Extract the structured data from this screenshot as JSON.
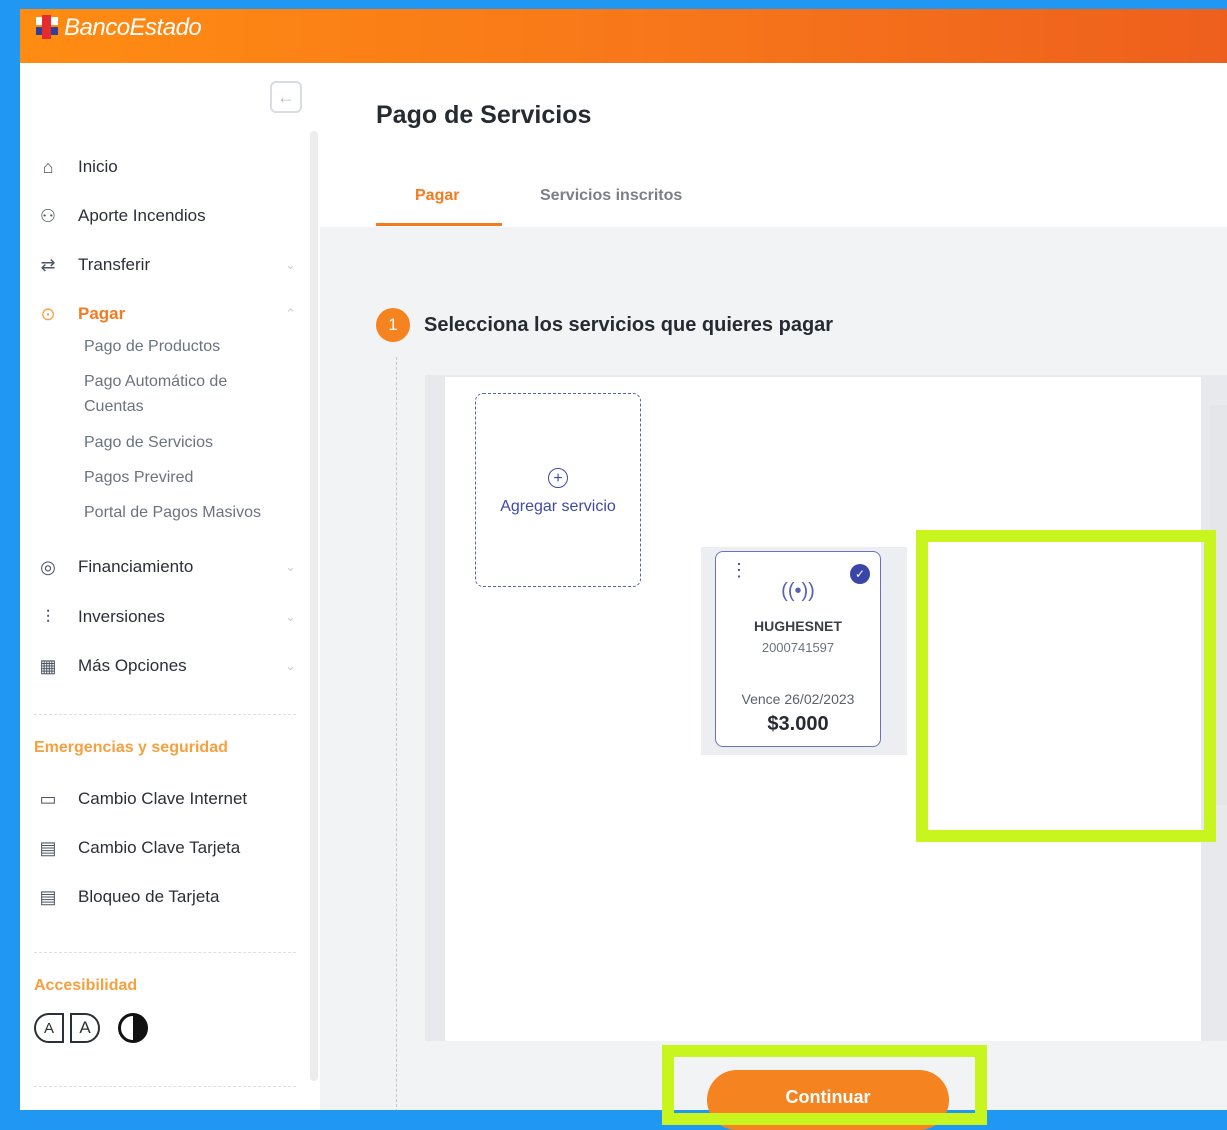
{
  "brand": {
    "name": "BancoEstado"
  },
  "sidebar": {
    "items": [
      {
        "label": "Inicio",
        "icon": "home-icon"
      },
      {
        "label": "Aporte Incendios",
        "icon": "people-icon"
      },
      {
        "label": "Transferir",
        "icon": "transfer-icon"
      },
      {
        "label": "Pagar",
        "icon": "dollar-icon",
        "active": true
      },
      {
        "label": "Financiamiento",
        "icon": "coins-icon"
      },
      {
        "label": "Inversiones",
        "icon": "chart-icon"
      },
      {
        "label": "Más Opciones",
        "icon": "grid-icon"
      }
    ],
    "pagar_sub": [
      "Pago de Productos",
      "Pago Automático de Cuentas",
      "Pago de Servicios",
      "Pagos Previred",
      "Portal de Pagos Masivos"
    ],
    "emergencias_title": "Emergencias y seguridad",
    "emergencias": [
      {
        "label": "Cambio Clave Internet",
        "icon": "key-card-icon"
      },
      {
        "label": "Cambio Clave Tarjeta",
        "icon": "card-lock-icon"
      },
      {
        "label": "Bloqueo de Tarjeta",
        "icon": "card-block-icon"
      }
    ],
    "accesibilidad_title": "Accesibilidad",
    "acc_small": "A",
    "acc_large": "A"
  },
  "main": {
    "title": "Pago de Servicios",
    "tabs": [
      "Pagar",
      "Servicios inscritos"
    ],
    "step": {
      "number": "1",
      "text": "Selecciona los servicios que quieres pagar"
    },
    "add_service": "Agregar servicio",
    "service": {
      "name": "HUGHESNET",
      "number": "2000741597",
      "due": "Vence 26/02/2023",
      "amount": "$3.000"
    },
    "continue": "Continuar"
  },
  "colors": {
    "accent": "#f47b20",
    "highlight": "#c8f51e",
    "link": "#3e4aa6"
  }
}
